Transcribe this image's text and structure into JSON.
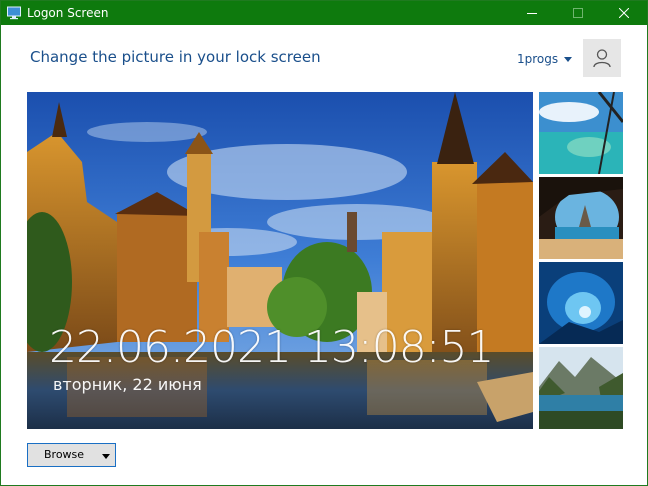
{
  "window": {
    "title": "Logon Screen",
    "title_bar_color": "#0e7a0d",
    "app_icon": "monitor-icon"
  },
  "titlebar": {
    "minimize_icon": "minimize-icon",
    "maximize_icon": "maximize-icon",
    "close_icon": "close-icon"
  },
  "header": {
    "title": "Change the picture in your lock screen",
    "user_name": "1progs",
    "avatar_icon": "user-icon",
    "accent": "#1a4f8b"
  },
  "preview": {
    "clock": "22.06.2021 13:08:51",
    "date": "вторник, 22 июня"
  },
  "thumbnails": [
    {
      "name": "tropical-beach"
    },
    {
      "name": "sea-cave"
    },
    {
      "name": "ice-cave"
    },
    {
      "name": "mountain-lake"
    }
  ],
  "browse": {
    "label": "Browse",
    "accent": "#1a6fc4"
  }
}
